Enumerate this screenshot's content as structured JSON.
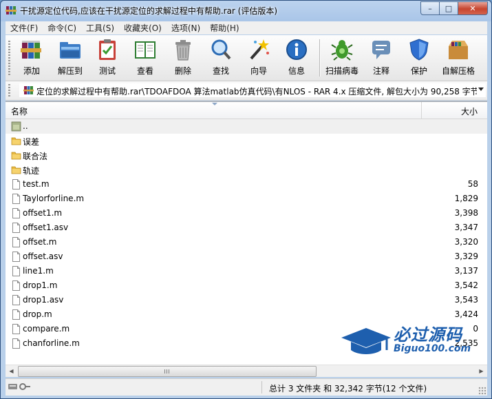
{
  "window": {
    "title": "干扰源定位代码,应该在干扰源定位的求解过程中有帮助.rar (评估版本)",
    "controls": {
      "minimize": "–",
      "maximize": "□",
      "close": "✕"
    }
  },
  "menu": [
    "文件(F)",
    "命令(C)",
    "工具(S)",
    "收藏夹(O)",
    "选项(N)",
    "帮助(H)"
  ],
  "toolbar": [
    {
      "label": "添加",
      "icon": "add-books-icon"
    },
    {
      "label": "解压到",
      "icon": "extract-folder-icon"
    },
    {
      "label": "测试",
      "icon": "test-clipboard-icon"
    },
    {
      "label": "查看",
      "icon": "view-book-icon"
    },
    {
      "label": "删除",
      "icon": "delete-trash-icon"
    },
    {
      "label": "查找",
      "icon": "find-magnifier-icon"
    },
    {
      "label": "向导",
      "icon": "wizard-wand-icon"
    },
    {
      "label": "信息",
      "icon": "info-icon"
    },
    {
      "label": "扫描病毒",
      "icon": "virus-scan-icon"
    },
    {
      "label": "注释",
      "icon": "comment-icon"
    },
    {
      "label": "保护",
      "icon": "shield-icon"
    },
    {
      "label": "自解压格",
      "icon": "sfx-box-icon"
    }
  ],
  "address": {
    "path": "定位的求解过程中有帮助.rar\\TDOAFDOA 算法matlab仿真代码\\有NLOS - RAR 4.x 压缩文件, 解包大小为 90,258 字节"
  },
  "columns": {
    "name": "名称",
    "size": "大小"
  },
  "files": [
    {
      "name": "..",
      "size": "",
      "type": "parent"
    },
    {
      "name": "误差",
      "size": "",
      "type": "folder"
    },
    {
      "name": "联合法",
      "size": "",
      "type": "folder"
    },
    {
      "name": "轨迹",
      "size": "",
      "type": "folder"
    },
    {
      "name": "test.m",
      "size": "58",
      "type": "file"
    },
    {
      "name": "Taylorforline.m",
      "size": "1,829",
      "type": "file"
    },
    {
      "name": "offset1.m",
      "size": "3,398",
      "type": "file"
    },
    {
      "name": "offset1.asv",
      "size": "3,347",
      "type": "file"
    },
    {
      "name": "offset.m",
      "size": "3,320",
      "type": "file"
    },
    {
      "name": "offset.asv",
      "size": "3,329",
      "type": "file"
    },
    {
      "name": "line1.m",
      "size": "3,137",
      "type": "file"
    },
    {
      "name": "drop1.m",
      "size": "3,542",
      "type": "file"
    },
    {
      "name": "drop1.asv",
      "size": "3,543",
      "type": "file"
    },
    {
      "name": "drop.m",
      "size": "3,424",
      "type": "file"
    },
    {
      "name": "compare.m",
      "size": "0",
      "type": "file"
    },
    {
      "name": "chanforline.m",
      "size": "2,535",
      "type": "file"
    }
  ],
  "status": {
    "summary": "总计 3 文件夹 和 32,342 字节(12 个文件)"
  },
  "watermark": {
    "line1": "必过源码",
    "line2": "Biguo100.com"
  }
}
